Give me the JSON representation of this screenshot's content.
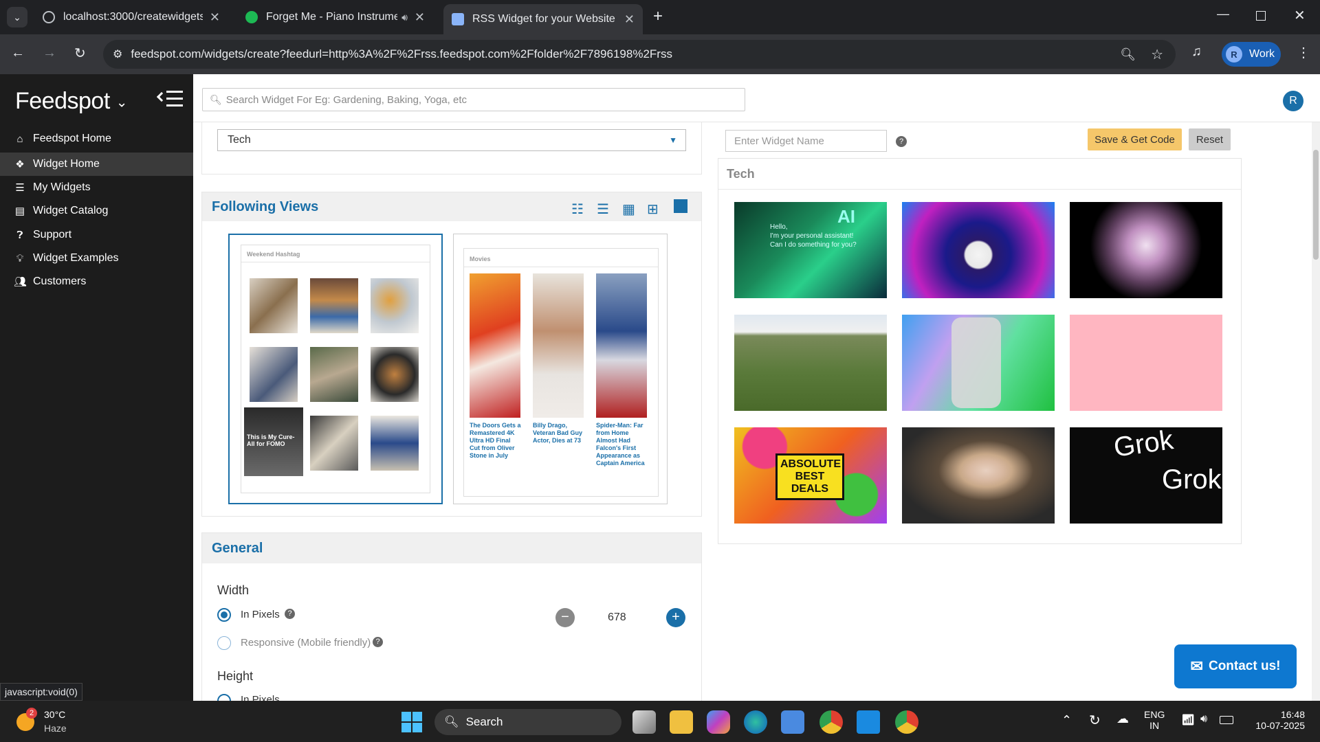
{
  "browser": {
    "tabs": [
      {
        "title": "localhost:3000/createwidgets"
      },
      {
        "title": "Forget Me - Piano Instrume"
      },
      {
        "title": "RSS Widget for your Website | F"
      }
    ],
    "url": "feedspot.com/widgets/create?feedurl=http%3A%2F%2Frss.feedspot.com%2Ffolder%2F7896198%2Frss",
    "profile_label": "Work",
    "profile_initial": "R"
  },
  "sidebar": {
    "logo": "Feedspot",
    "items": [
      {
        "label": "Feedspot Home",
        "icon": "home-icon"
      },
      {
        "label": "Widget Home",
        "icon": "cubes-icon"
      },
      {
        "label": "My Widgets",
        "icon": "list-icon"
      },
      {
        "label": "Widget Catalog",
        "icon": "catalog-icon"
      },
      {
        "label": "Support",
        "icon": "question-icon"
      },
      {
        "label": "Widget Examples",
        "icon": "bulb-icon"
      },
      {
        "label": "Customers",
        "icon": "users-icon"
      }
    ]
  },
  "header": {
    "search_placeholder": "Search Widget For Eg: Gardening, Baking, Yoga, etc",
    "user_initial": "R"
  },
  "folder_select": {
    "value": "Tech"
  },
  "following_views": {
    "title": "Following Views",
    "preview1": {
      "heading": "Weekend Hashtag",
      "overlay_text": "This is My Cure-All for FOMO"
    },
    "preview2": {
      "heading": "Movies",
      "captions": [
        "The Doors Gets a Remastered 4K Ultra HD Final Cut from Oliver Stone in July",
        "Billy Drago, Veteran Bad Guy Actor, Dies at 73",
        "Spider-Man: Far from Home Almost Had Falcon's First Appearance as Captain America"
      ]
    }
  },
  "general": {
    "title": "General",
    "width_label": "Width",
    "in_pixels": "In Pixels",
    "responsive": "Responsive (Mobile friendly)",
    "width_value": "678",
    "height_label": "Height",
    "height_in_pixels": "In Pixels"
  },
  "widget": {
    "name_placeholder": "Enter Widget Name",
    "save_label": "Save & Get Code",
    "reset_label": "Reset",
    "feed_title": "Tech",
    "ai_text": "AI",
    "ai_hello": "Hello,\nI'm your personal assistant!\nCan I do something for you?",
    "deals_text": "ABSOLUTE BEST DEALS",
    "grok_text": "Grok"
  },
  "contact_label": "Contact us!",
  "status_bar": "javascript:void(0)",
  "taskbar": {
    "weather_temp": "30°C",
    "weather_desc": "Haze",
    "weather_badge": "2",
    "search_label": "Search",
    "lang1": "ENG",
    "lang2": "IN",
    "time": "16:48",
    "date": "10-07-2025"
  },
  "colors": {
    "accent": "#1a6fa8",
    "save_button": "#f5c76a",
    "sidebar_bg": "#1c1c1c",
    "contact": "#0e78d0"
  }
}
